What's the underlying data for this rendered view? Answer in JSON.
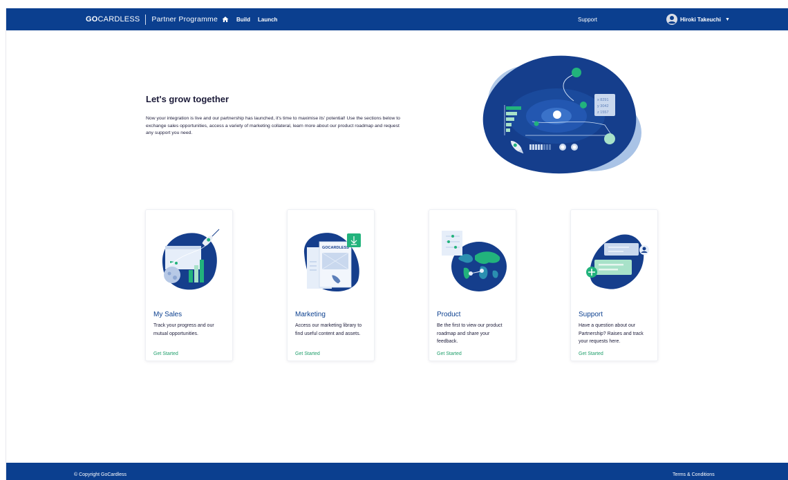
{
  "header": {
    "brand_go": "GO",
    "brand_cardless": "CARDLESS",
    "brand_programme": "Partner Programme",
    "nav": {
      "home_icon": "home-icon",
      "build": "Build",
      "launch": "Launch"
    },
    "support": "Support",
    "user_name": "Hiroki Takeuchi",
    "user_icon": "user-avatar-icon",
    "caret_icon": "caret-down-icon"
  },
  "hero": {
    "title": "Let's grow together",
    "text": "Now your integration is live and our partnership has launched, it's time to maximise its' potential! Use the sections below to exchange sales opportunities, access a variety of marketing collateral, learn more about our product roadmap and request any support you need.",
    "art_values": [
      "x 8291",
      "y 3042",
      "z 1557"
    ]
  },
  "cards": [
    {
      "title": "My Sales",
      "description": "Track your progress and our mutual opportunities.",
      "cta": "Get Started"
    },
    {
      "title": "Marketing",
      "description": "Access our marketing library to find useful content and assets.",
      "cta": "Get Started",
      "art_label": "GOCARDLESS"
    },
    {
      "title": "Product",
      "description": "Be the first to view our product roadmap and share your feedback.",
      "cta": "Get Started"
    },
    {
      "title": "Support",
      "description": "Have a question about our Partnership? Raises and track your requests here.",
      "cta": "Get Started"
    }
  ],
  "footer": {
    "copyright": "© Copyright GoCardless",
    "terms": "Terms & Conditions"
  },
  "colors": {
    "header_bg": "#0b3f8f",
    "accent_green": "#1e9e6a",
    "card_title": "#0b3f8f",
    "text": "#1c1b39"
  }
}
